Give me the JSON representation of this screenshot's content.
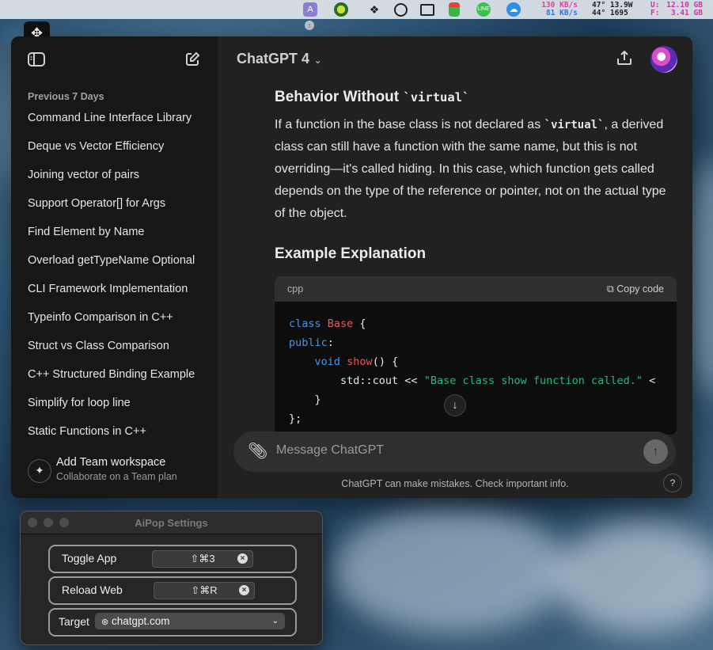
{
  "menubar": {
    "net_up": "130 KB/s",
    "net_down": "81 KB/s",
    "temp1": "47°",
    "power": "13.9W",
    "temp2": "44°",
    "fan": "1695",
    "mem_u_label": "U:",
    "mem_u": "12.10 GB",
    "mem_f_label": "F:",
    "mem_f": "3.41 GB"
  },
  "sidebar": {
    "section": "Previous 7 Days",
    "items": [
      "Command Line Interface Library",
      "Deque vs Vector Efficiency",
      "Joining vector of pairs",
      "Support Operator[] for Args",
      "Find Element by Name",
      "Overload getTypeName Optional",
      "CLI Framework Implementation",
      "Typeinfo Comparison in C++",
      "Struct vs Class Comparison",
      "C++ Structured Binding Example",
      "Simplify for loop line",
      "Static Functions in C++"
    ],
    "team_title": "Add Team workspace",
    "team_sub": "Collaborate on a Team plan"
  },
  "header": {
    "model": "ChatGPT 4"
  },
  "content": {
    "heading1_text": "Behavior Without ",
    "heading1_code": "`virtual`",
    "para_a": "If a function in the base class is not declared as ",
    "para_code": "`virtual`",
    "para_b": ", a derived class can still have a function with the same name, but this is not overriding—it's called hiding. In this case, which function gets called depends on the type of the reference or pointer, not on the actual type of the object.",
    "heading2": "Example Explanation"
  },
  "code": {
    "lang": "cpp",
    "copy_label": "Copy code",
    "lines": [
      [
        [
          "kw",
          "class"
        ],
        [
          "",
          " "
        ],
        [
          "cls",
          "Base"
        ],
        [
          "",
          " {"
        ]
      ],
      [
        [
          "kw",
          "public"
        ],
        [
          "",
          ":"
        ]
      ],
      [
        [
          "",
          "    "
        ],
        [
          "kw",
          "void"
        ],
        [
          "",
          " "
        ],
        [
          "cls",
          "show"
        ],
        [
          "",
          "() {"
        ]
      ],
      [
        [
          "",
          "        std::cout << "
        ],
        [
          "str",
          "\"Base class show function called.\""
        ],
        [
          "",
          " <"
        ]
      ],
      [
        [
          "",
          "    }"
        ]
      ],
      [
        [
          "",
          "};"
        ]
      ]
    ]
  },
  "composer": {
    "placeholder": "Message ChatGPT"
  },
  "disclaimer": "ChatGPT can make mistakes. Check important info.",
  "help": "?",
  "aipop": {
    "title": "AiPop Settings",
    "toggle_label": "Toggle App",
    "toggle_key": "⇧⌘3",
    "reload_label": "Reload Web",
    "reload_key": "⇧⌘R",
    "target_label": "Target",
    "target_value": "chatgpt.com"
  }
}
